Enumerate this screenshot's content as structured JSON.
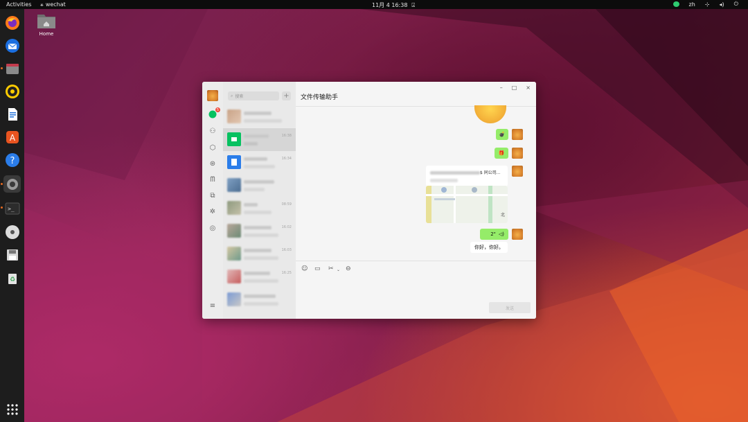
{
  "topbar": {
    "activities": "Activities",
    "app_name": "wechat",
    "clock": "11月 4 16:38",
    "lang": "zh",
    "icons": [
      "wechat-tray-icon",
      "network-icon",
      "volume-icon",
      "power-icon"
    ]
  },
  "dock": {
    "items": [
      "firefox",
      "thunderbird",
      "files",
      "rhythmbox",
      "writer",
      "app-center",
      "help",
      "settings",
      "terminal",
      "disc",
      "save-disk",
      "trash"
    ],
    "show_apps": "show-apps-grid"
  },
  "desktop": {
    "home_label": "Home"
  },
  "wechat": {
    "search_placeholder": "搜索",
    "plus": "+",
    "chat_title": "文件传输助手",
    "chats": [
      {
        "time": ""
      },
      {
        "time": "16:38"
      },
      {
        "time": "16:34"
      },
      {
        "time": ""
      },
      {
        "time": "08:59"
      },
      {
        "time": "16:02"
      },
      {
        "time": "16:03"
      },
      {
        "time": "16:25"
      },
      {
        "time": ""
      }
    ],
    "messages": {
      "file_company": "$ 同公司...",
      "map_label": "北",
      "voice_duration": "2\"",
      "text_reply": "你好，你好。"
    },
    "send_label": "发送",
    "window_controls": {
      "minimize": "–",
      "maximize": "□",
      "close": "×"
    },
    "colors": {
      "bubble_green": "#95ec69",
      "accent": "#07c160"
    }
  }
}
